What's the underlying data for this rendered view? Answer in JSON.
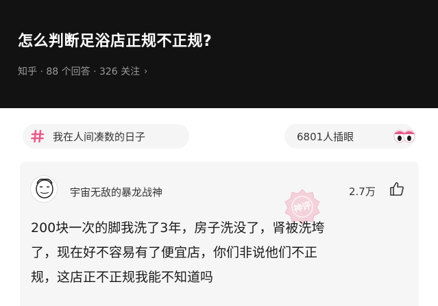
{
  "question": {
    "title": "怎么判断足浴店正规不正规?",
    "meta": "知乎 · 88 个回答 · 326 关注",
    "chevron_icon": "chevron-right-icon"
  },
  "topic": {
    "icon": "hash-icon",
    "label": "我在人间凑数的日子"
  },
  "stats": {
    "views": "6801人插眼",
    "icon": "eyes-icon"
  },
  "answer": {
    "author": "宇宙无敌的暴龙战神",
    "likes": "2.7万",
    "like_icon": "thumbs-up-icon",
    "watermark": "神评",
    "lines": [
      "200块一次的脚我洗了3年，房子洗没了，肾被洗垮",
      "了，现在好不容易有了便宜店，你们非说他们不正",
      "规，这店正不正规我能不知道吗"
    ]
  },
  "colors": {
    "header_bg": "#121212",
    "accent_pink": "#e85a8a",
    "text_dark": "#1a1a1a"
  }
}
